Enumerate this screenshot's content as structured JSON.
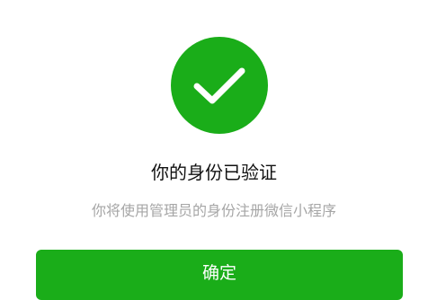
{
  "result": {
    "icon": "check-icon",
    "title": "你的身份已验证",
    "subtitle": "你将使用管理员的身份注册微信小程序"
  },
  "actions": {
    "confirm_label": "确定"
  },
  "colors": {
    "brand_green": "#1aad19",
    "title_text": "#111111",
    "subtitle_text": "#a6a6a6",
    "background": "#ffffff"
  }
}
